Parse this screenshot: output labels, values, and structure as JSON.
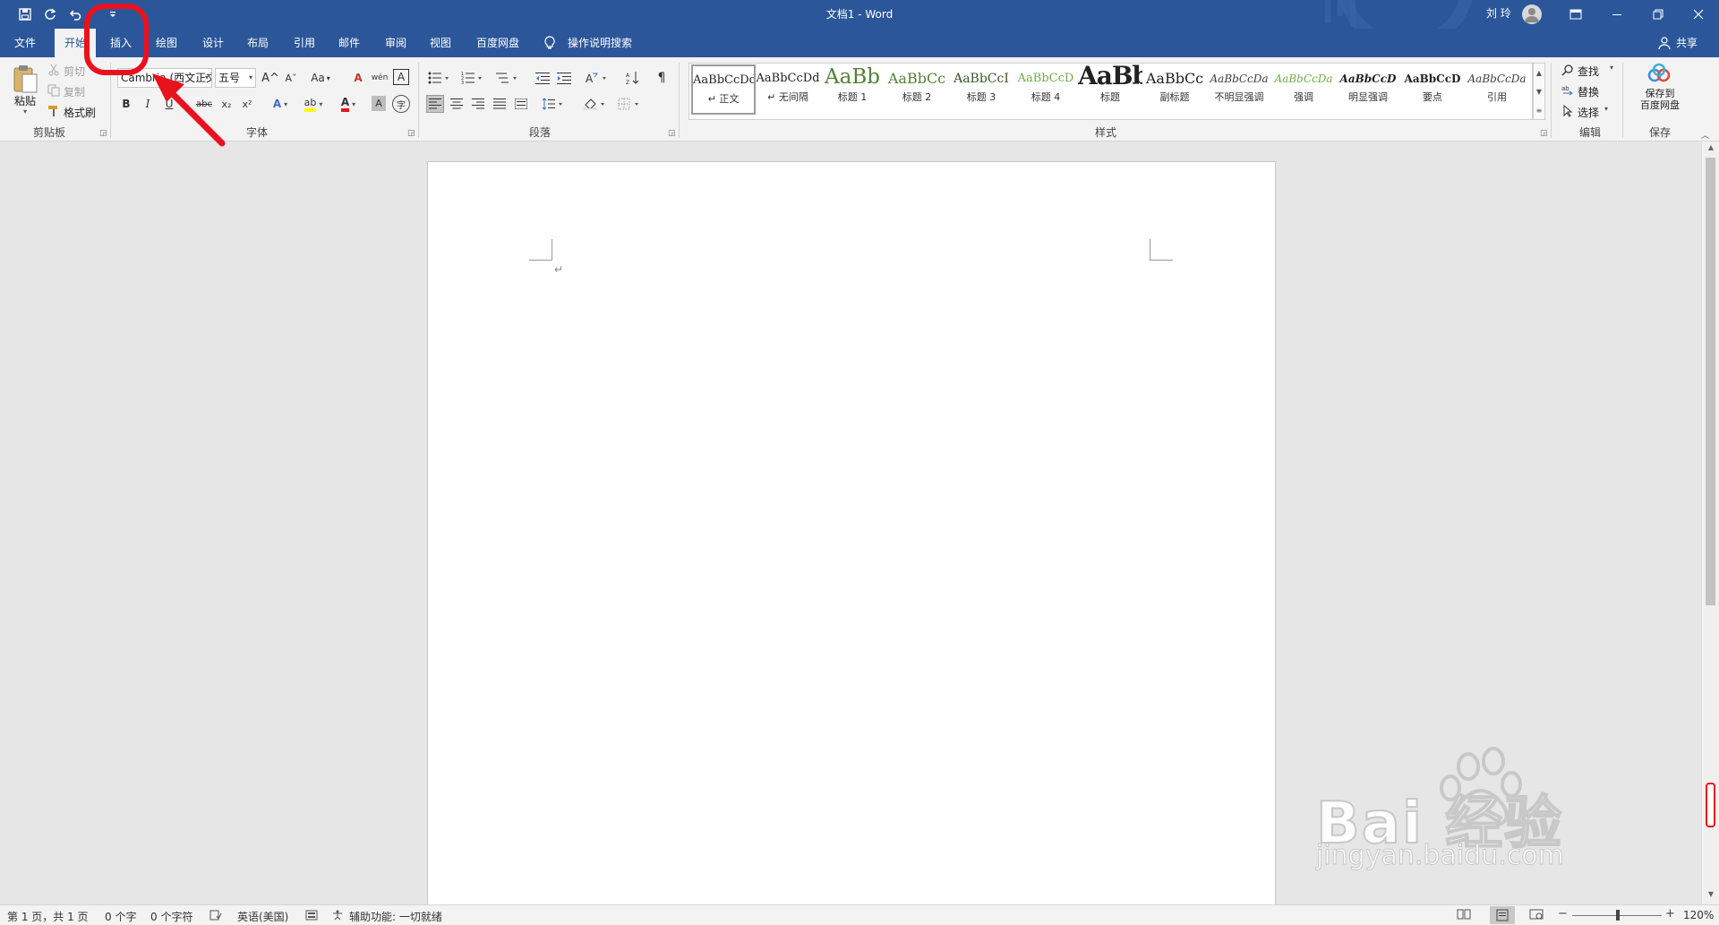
{
  "window": {
    "title": "文档1 - Word",
    "user_name": "刘 玲"
  },
  "quick_access": {
    "save_icon": "save-icon",
    "redo_icon": "redo-icon",
    "undo_icon": "undo-icon",
    "customize_icon": "customize-quick-access-icon"
  },
  "tabs": [
    {
      "label": "文件"
    },
    {
      "label": "开始"
    },
    {
      "label": "插入"
    },
    {
      "label": "绘图"
    },
    {
      "label": "设计"
    },
    {
      "label": "布局"
    },
    {
      "label": "引用"
    },
    {
      "label": "邮件"
    },
    {
      "label": "审阅"
    },
    {
      "label": "视图"
    },
    {
      "label": "百度网盘"
    }
  ],
  "tell_me": "操作说明搜索",
  "share": "共享",
  "clipboard": {
    "paste": "粘贴",
    "cut": "剪切",
    "copy": "复制",
    "format_painter": "格式刷",
    "group": "剪贴板"
  },
  "font": {
    "name": "Cambria (西文正文)",
    "size": "五号",
    "group": "字体",
    "bold": "B",
    "italic": "I",
    "underline": "U",
    "strike": "abc",
    "subscript": "x₂",
    "superscript": "x²",
    "grow": "A^",
    "shrink": "Aˇ",
    "case": "Aa",
    "clear": "A",
    "phonetic": "wén",
    "border": "A",
    "effects": "A",
    "highlight": "ab",
    "color": "A",
    "shading": "A",
    "enclose": "字"
  },
  "paragraph": {
    "group": "段落"
  },
  "styles": {
    "group": "样式",
    "items": [
      {
        "preview": "AaBbCcDd",
        "label": "↵ 正文"
      },
      {
        "preview": "AaBbCcDd",
        "label": "↵ 无间隔"
      },
      {
        "preview": "AaBb",
        "label": "标题 1"
      },
      {
        "preview": "AaBbCc",
        "label": "标题 2"
      },
      {
        "preview": "AaBbCcI",
        "label": "标题 3"
      },
      {
        "preview": "AaBbCcD",
        "label": "标题 4"
      },
      {
        "preview": "AaBbC",
        "label": "标题"
      },
      {
        "preview": "AaBbCc",
        "label": "副标题"
      },
      {
        "preview": "AaBbCcDa",
        "label": "不明显强调"
      },
      {
        "preview": "AaBbCcDa",
        "label": "强调"
      },
      {
        "preview": "AaBbCcD",
        "label": "明显强调"
      },
      {
        "preview": "AaBbCcD",
        "label": "要点"
      },
      {
        "preview": "AaBbCcDa",
        "label": "引用"
      }
    ]
  },
  "editing": {
    "find": "查找",
    "replace": "替换",
    "select": "选择",
    "group": "编辑"
  },
  "save_group": {
    "button": "保存到\n百度网盘",
    "group": "保存"
  },
  "document": {
    "paragraph_mark": "↵"
  },
  "status": {
    "page": "第 1 页，共 1 页",
    "words": "0 个字",
    "chars": "0 个字符",
    "language": "英语(美国)",
    "accessibility": "辅助功能: 一切就绪",
    "zoom": "120%"
  },
  "watermark": {
    "brand": "Bai 经验",
    "url": "jingyan.baidu.com"
  },
  "colors": {
    "title_bar": "#2b579a",
    "ribbon": "#f3f3f3",
    "annotation": "#e8121d"
  }
}
